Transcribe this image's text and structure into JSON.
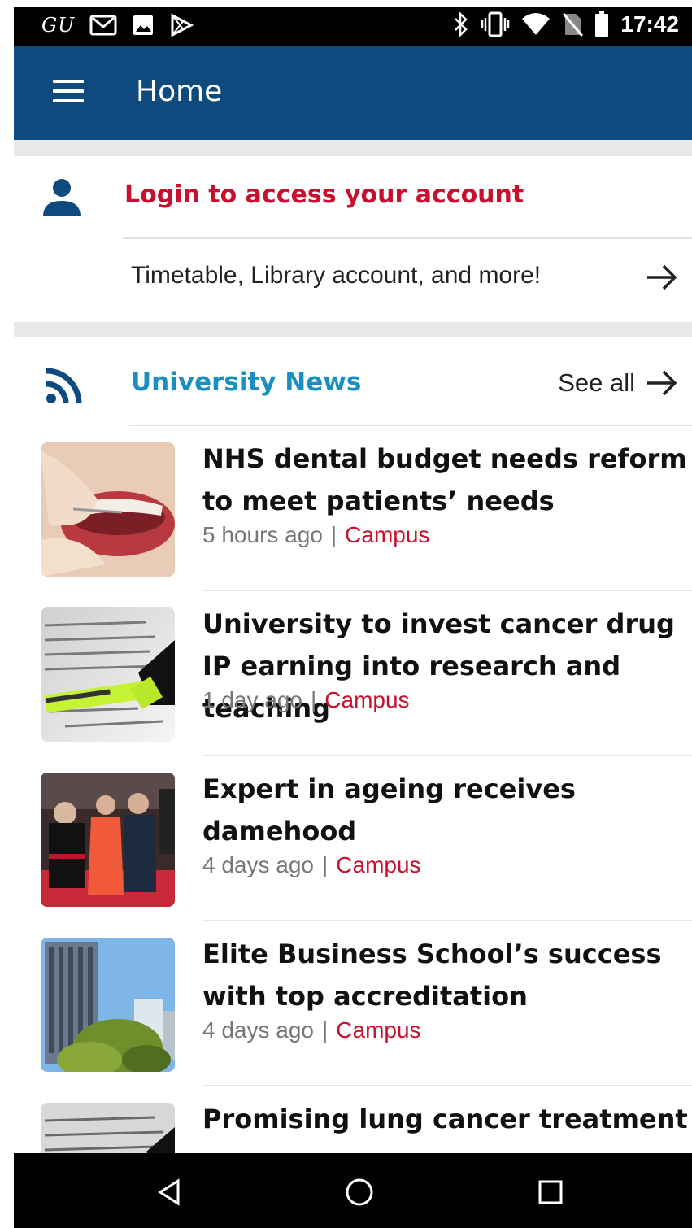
{
  "status_bar": {
    "carrier_text": "GU",
    "time": "17:42",
    "left_icons": [
      "gmail-icon",
      "image-icon",
      "play-store-icon"
    ],
    "right_icons": [
      "bluetooth-icon",
      "vibrate-icon",
      "wifi-icon",
      "no-sim-icon",
      "battery-icon"
    ]
  },
  "app_bar": {
    "title": "Home"
  },
  "login": {
    "title": "Login to access your account",
    "subtitle": "Timetable, Library account, and more!"
  },
  "news": {
    "section_title": "University News",
    "see_all_label": "See all",
    "separator": "|",
    "items": [
      {
        "headline": "NHS dental budget needs reform to meet patients’ needs",
        "time": "5 hours ago",
        "category": "Campus",
        "thumbnail": "dental-photo"
      },
      {
        "headline": "University to invest cancer drug IP earning into research and teaching",
        "time": "1 day ago",
        "category": "Campus",
        "thumbnail": "cancer-highlight-photo"
      },
      {
        "headline": "Expert in ageing receives damehood",
        "time": "4 days ago",
        "category": "Campus",
        "thumbnail": "ceremony-photo"
      },
      {
        "headline": "Elite Business School’s success with top accreditation",
        "time": "4 days ago",
        "category": "Campus",
        "thumbnail": "building-photo"
      },
      {
        "headline": "Promising lung cancer treatment",
        "time": "",
        "category": "",
        "thumbnail": "cancer-text-photo"
      }
    ]
  },
  "nav_bar": {
    "icons": [
      "back-icon",
      "home-icon",
      "recents-icon"
    ]
  },
  "colors": {
    "app_bar": "#0f4a7e",
    "accent_red": "#c8102e",
    "news_blue": "#1a8fc0"
  }
}
